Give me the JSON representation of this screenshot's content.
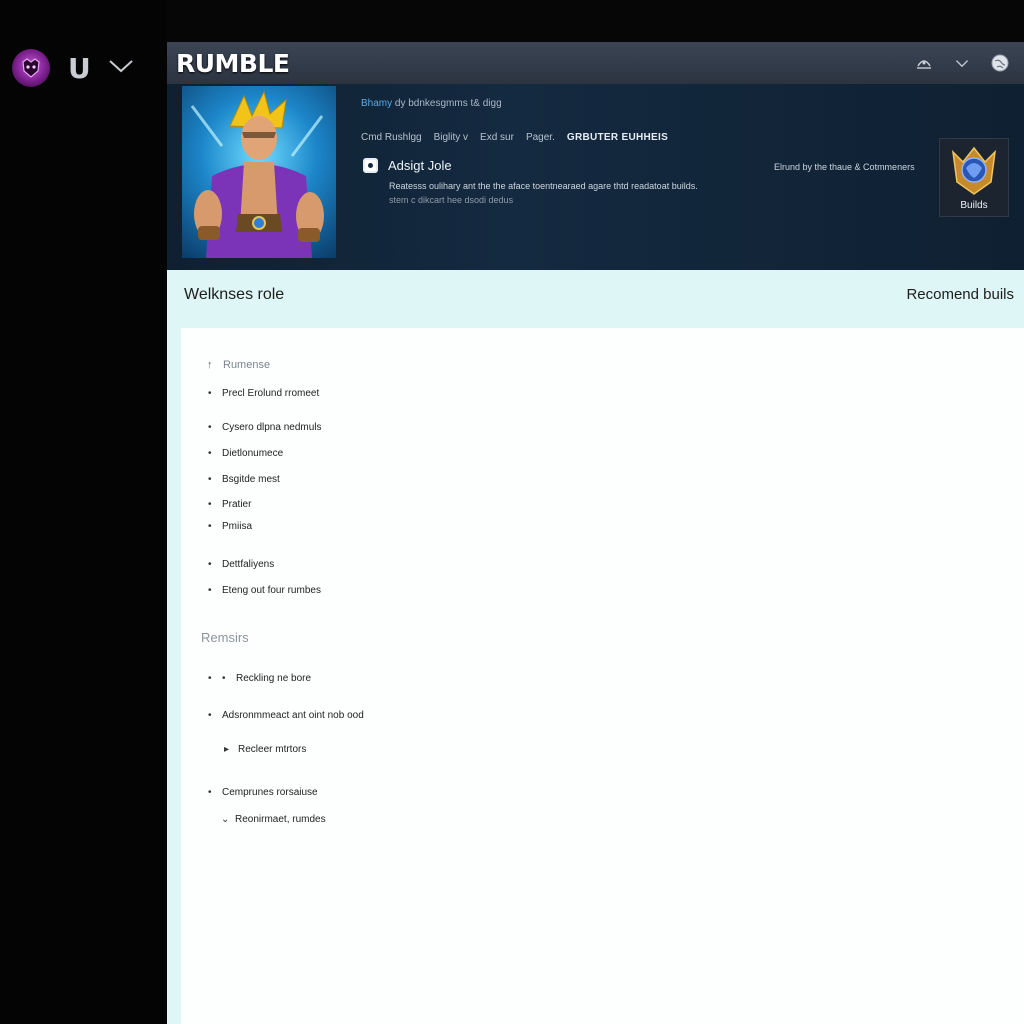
{
  "sidebar": {
    "u_label": "U"
  },
  "window": {
    "title": "RUMBLE"
  },
  "hero": {
    "line1_highlight": "Bhamy",
    "line1_rest": "dy bdnkesgmms  t&  digg",
    "nav": [
      "Cmd Rushlgg",
      "Biglity v",
      "Exd sur",
      "Pager.",
      "GRBUTER  EUHHEIS"
    ],
    "role_label": "Adsigt Jole",
    "desc1": "Reatesss oulihary ant the the aface toentnearaed agare thtd readatoat builds.",
    "desc2": "stem c dikcart hee dsodi dedus",
    "right_text": "Elrund by the thaue & Cotmmeners",
    "builds_label": "Builds"
  },
  "section": {
    "left_title": "Welknses role",
    "right_link": "Recomend buils"
  },
  "content": {
    "group1_head": "Rumense",
    "group1_marker": "↑",
    "group1_items": [
      "Precl Erolund rromeet",
      "Cysero dlpna nedmuls",
      "Dietlonumece",
      "Bsgitde mest",
      "Pratier",
      "Pmiisa",
      "Dettfaliyens",
      "Eteng out four rumbes"
    ],
    "group2_head": "Remsirs",
    "group2_items": [
      "Reckling ne bore",
      "Adsronmmeact ant oint nob ood",
      "Recleer mtrtors",
      "Cemprunes rorsaiuse",
      "Reonirmaet, rumdes"
    ],
    "bullets": {
      "dot": "•",
      "arrow": "▸",
      "dash": "⌄"
    }
  },
  "colors": {
    "hero_bg": "#142a40",
    "section_bg": "#dff6f6",
    "accent_blue": "#5aa9e6"
  },
  "icons": [
    "app-logo-icon",
    "chevron-down-icon",
    "sound-icon",
    "minimize-chevron-icon",
    "globe-icon",
    "role-icon",
    "builds-emblem-icon"
  ]
}
